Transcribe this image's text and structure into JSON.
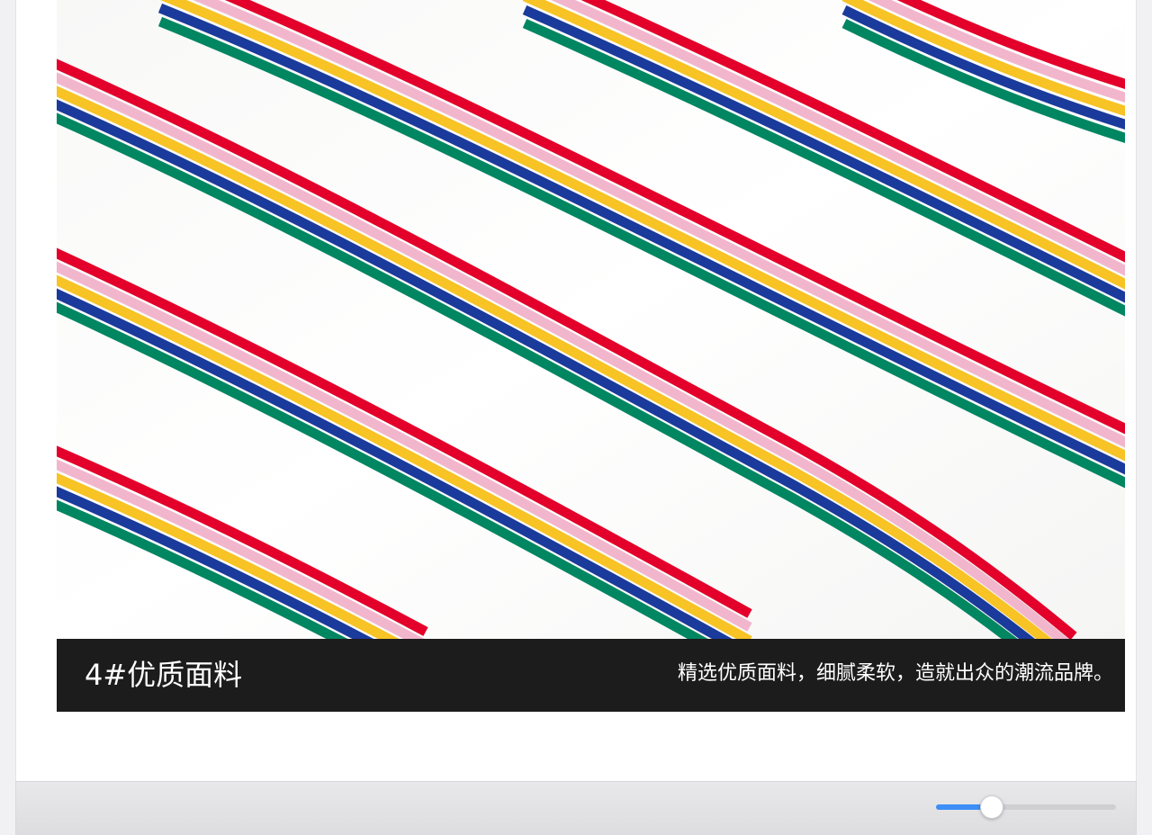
{
  "window": {
    "background_color": "#f1f1f3"
  },
  "product_section": {
    "image": {
      "description": "白底彩色斜条纹面料",
      "stripe_colors": [
        "#e3002a",
        "#f2b6cc",
        "#f7c325",
        "#1a3b9b",
        "#008661"
      ]
    },
    "caption": {
      "title": "4#优质面料",
      "description": "精选优质面料，细腻柔软，造就出众的潮流品牌。",
      "background_color": "#1c1c1c",
      "text_color": "#ffffff"
    }
  },
  "toolbar": {
    "zoom_slider": {
      "value_fraction": 0.31,
      "accent_color": "#3d8ef7"
    }
  }
}
